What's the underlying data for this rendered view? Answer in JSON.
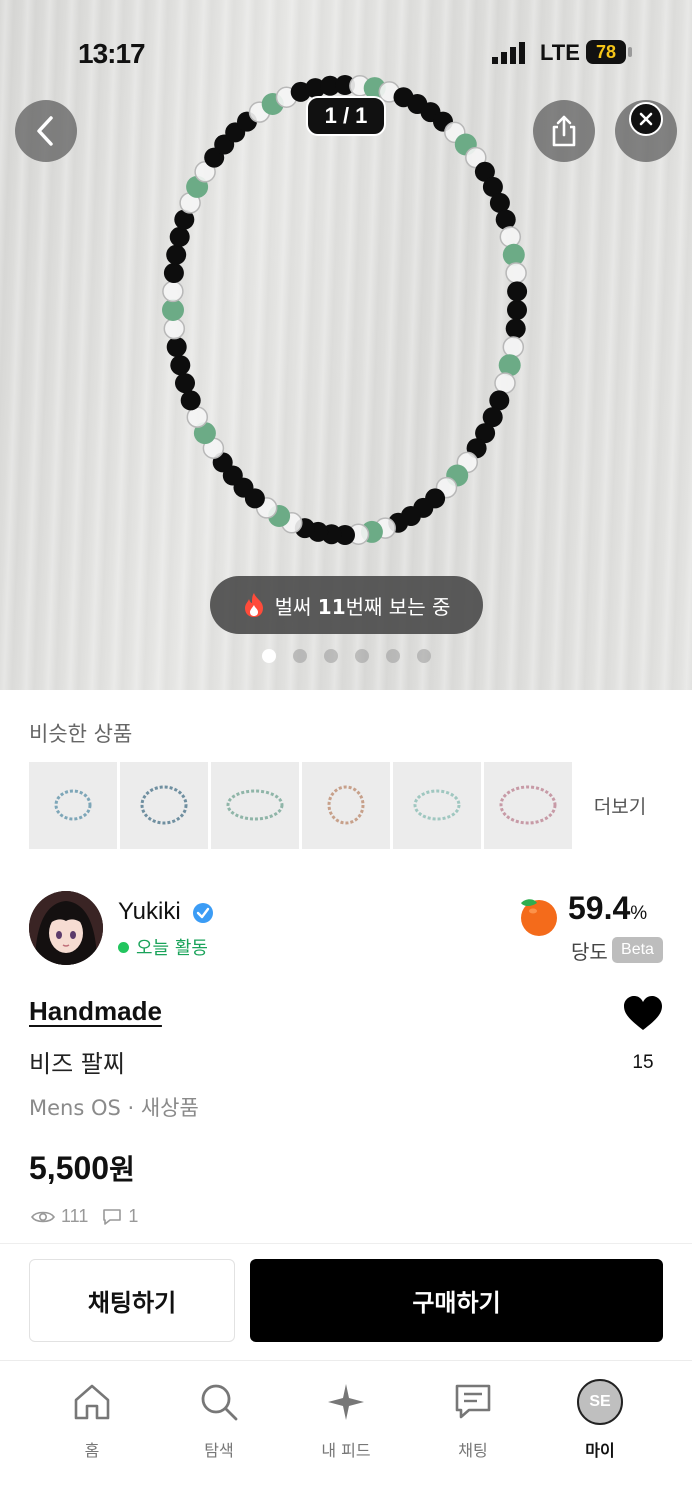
{
  "status_bar": {
    "time": "13:17",
    "network": "LTE",
    "battery": "78"
  },
  "gallery": {
    "counter": "1 / 1",
    "viewers_prefix": "벌써 ",
    "viewers_count": "11",
    "viewers_suffix": "번째 보는 중",
    "dots_total": 6,
    "dots_active": 0
  },
  "similar": {
    "title": "비슷한 상품",
    "more_label": "더보기",
    "thumbs": [
      {
        "name": "bracelet-thumb-1",
        "color": "#7da6b8"
      },
      {
        "name": "bracelet-thumb-2",
        "color": "#6f8fa0"
      },
      {
        "name": "bracelet-thumb-3",
        "color": "#8fb5a8"
      },
      {
        "name": "bracelet-thumb-4",
        "color": "#c7a08a"
      },
      {
        "name": "bracelet-thumb-5",
        "color": "#9fc7c0"
      },
      {
        "name": "bracelet-thumb-6",
        "color": "#c79aa6"
      }
    ]
  },
  "seller": {
    "name": "Yukiki",
    "activity": "오늘 활동",
    "score": "59.4",
    "score_unit": "%",
    "score_label": "당도",
    "beta_label": "Beta"
  },
  "product": {
    "brand": "Handmade",
    "name": "비즈 팔찌",
    "category": "Mens OS · 새상품",
    "price": "5,500",
    "price_unit": "원",
    "likes": "15",
    "views": "111",
    "comments": "1"
  },
  "actions": {
    "chat_label": "채팅하기",
    "buy_label": "구매하기"
  },
  "tabbar": {
    "items": [
      {
        "label": "홈",
        "icon": "home-icon"
      },
      {
        "label": "탐색",
        "icon": "search-icon"
      },
      {
        "label": "내 피드",
        "icon": "sparkle-icon"
      },
      {
        "label": "채팅",
        "icon": "chat-icon"
      },
      {
        "label": "마이",
        "icon": "profile-avatar",
        "avatar_text": "SE"
      }
    ],
    "active_index": 4
  },
  "colors": {
    "accent_black": "#000000",
    "active_green": "#22c55e",
    "score_orange": "#f46b1b",
    "verified_blue": "#3b9cf5"
  }
}
